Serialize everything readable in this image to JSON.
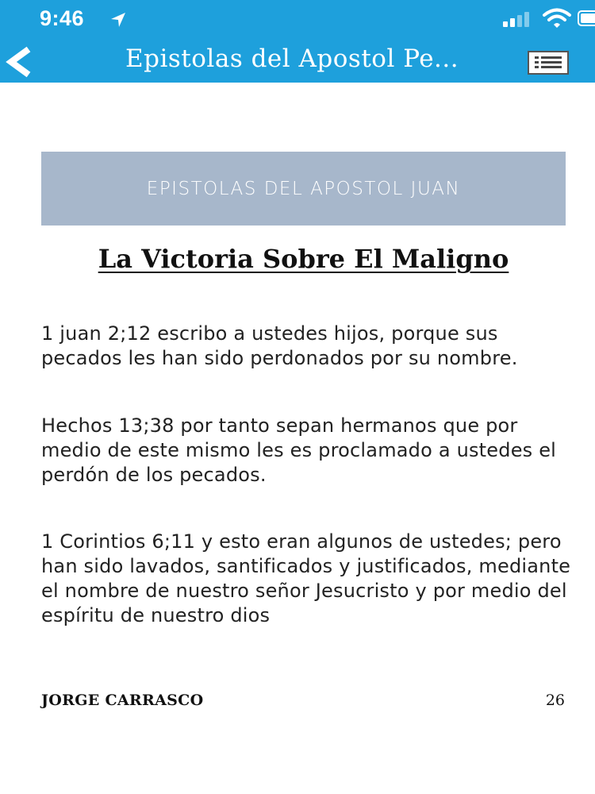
{
  "status_bar": {
    "time": "9:46"
  },
  "nav_bar": {
    "title": "Epistolas del Apostol Pe..."
  },
  "banner": {
    "text": "EPISTOLAS DEL APOSTOL JUAN"
  },
  "chapter": {
    "title": "La Victoria Sobre El Maligno",
    "paragraphs": [
      "1 juan 2;12 escribo a ustedes hijos, porque sus pecados les han sido perdonados por su nombre.",
      "Hechos 13;38 por tanto sepan hermanos que por medio de este mismo les es proclamado a ustedes el perdón de los pecados.",
      "1 Corintios 6;11 y esto eran algunos de ustedes; pero han sido lavados, santificados y justificados, mediante el nombre de nuestro señor Jesucristo y por medio del espíritu de nuestro dios"
    ]
  },
  "footer": {
    "author": "JORGE CARRASCO",
    "page_number": "26"
  },
  "colors": {
    "nav_background": "#1ea0dc",
    "banner_background": "#a7b7cb"
  }
}
